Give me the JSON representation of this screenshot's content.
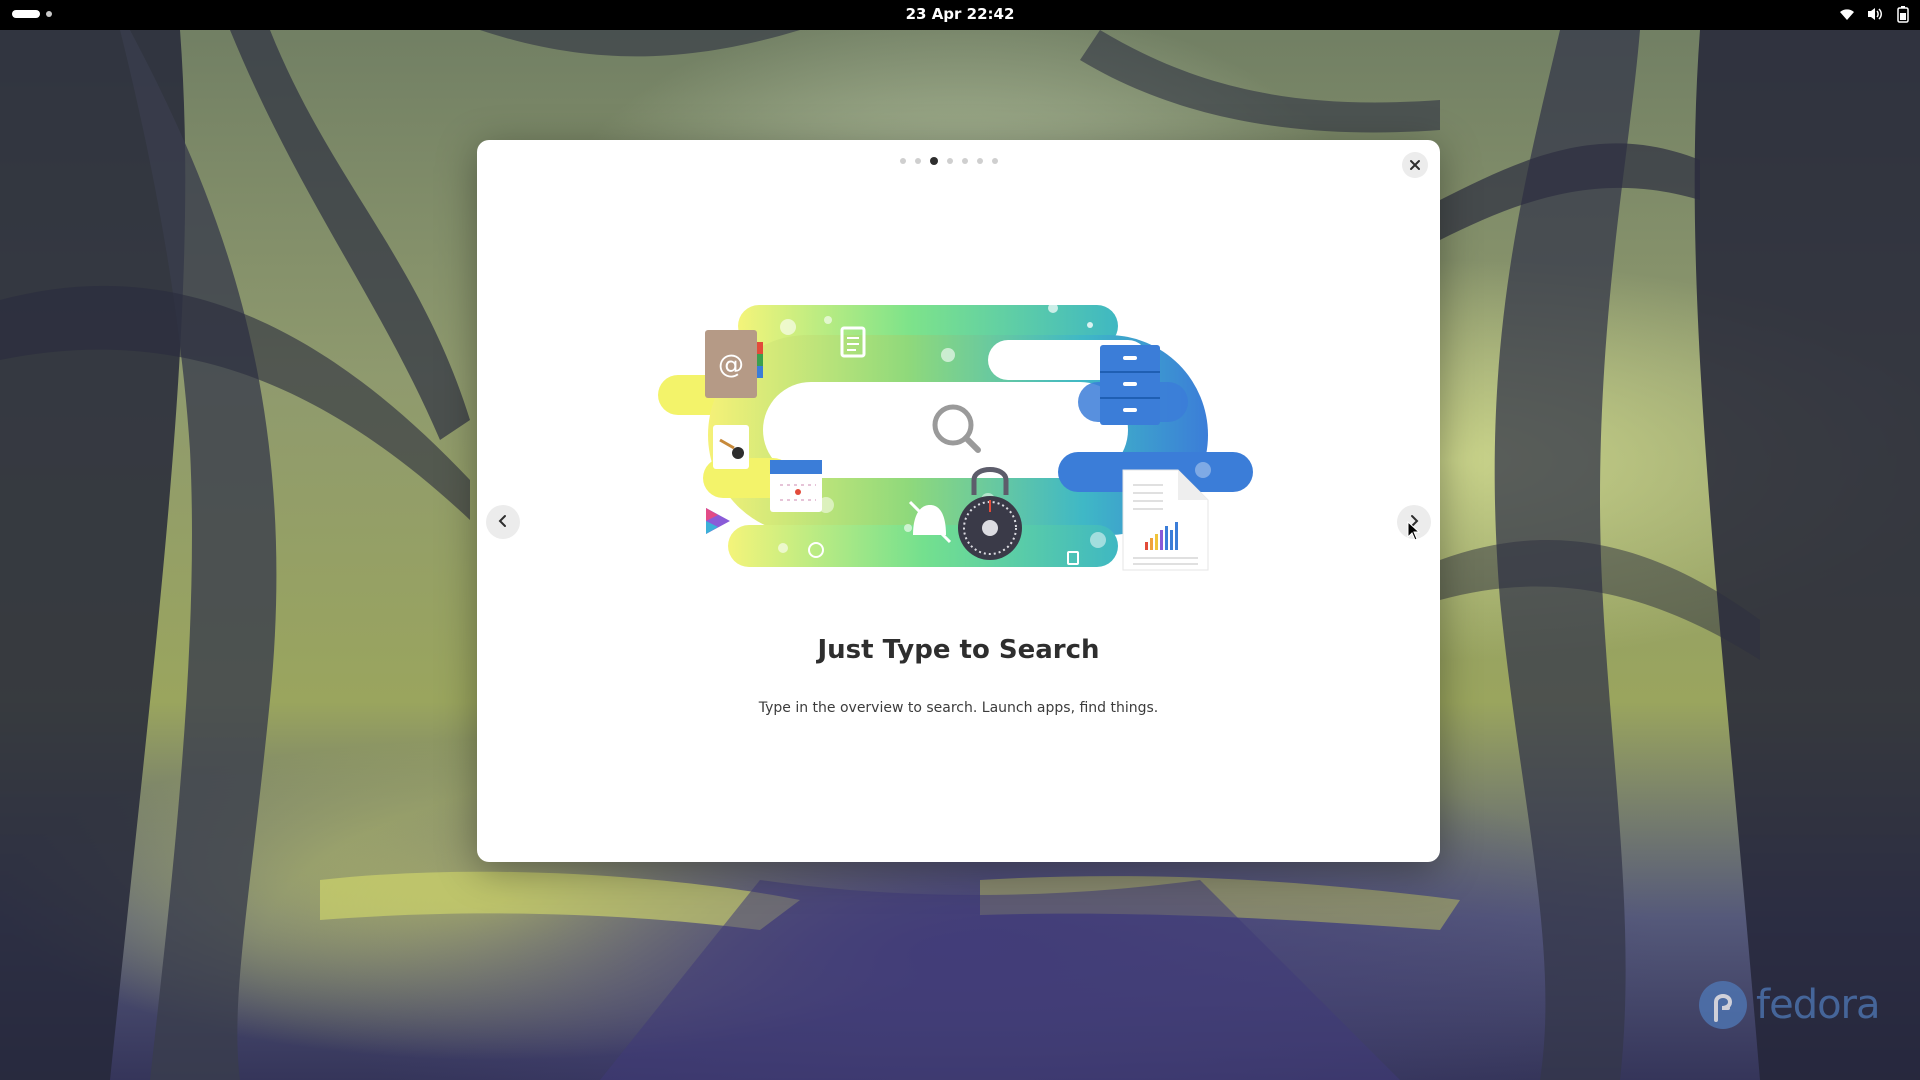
{
  "topbar": {
    "clock": "23 Apr  22:42",
    "tray_icons": [
      "wifi-icon",
      "volume-icon",
      "battery-icon"
    ]
  },
  "tour_dialog": {
    "page_count": 7,
    "active_page": 3,
    "title": "Just Type to Search",
    "subtitle": "Type in the overview to search. Launch apps, find things.",
    "illustration_icons": [
      "contacts-icon",
      "document-icon",
      "files-icon",
      "search-icon",
      "calendar-icon",
      "lock-icon",
      "spreadsheet-icon",
      "video-icon",
      "notifications-off-icon",
      "paint-icon"
    ]
  },
  "branding": {
    "logo_text": "fedora",
    "logo_color": "#4f79b8"
  },
  "colors": {
    "topbar": "#000000",
    "dialog_bg": "#ffffff",
    "accent_blue": "#3b7dd8"
  }
}
